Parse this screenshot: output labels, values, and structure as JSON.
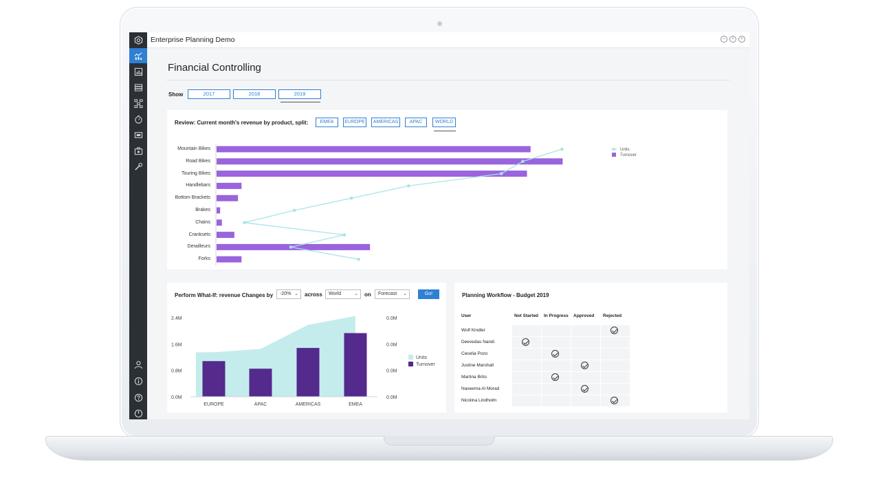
{
  "app": {
    "title": "Enterprise Planning Demo"
  },
  "page": {
    "title": "Financial Controlling"
  },
  "show": {
    "label": "Show",
    "years": [
      "2017",
      "2018",
      "2019"
    ],
    "selected": "2019"
  },
  "review": {
    "title": "Review: Current month's revenue by product, split:",
    "regions": [
      "EMEA",
      "EUROPE",
      "AMERICAS",
      "APAC",
      "WORLD"
    ],
    "selected_region": "WORLD"
  },
  "whatif": {
    "title": "Perform What-If: revenue Changes by",
    "change_value": "-20%",
    "across_label": "across",
    "region_value": "World",
    "on_label": "on",
    "scenario_value": "Forecast",
    "go_label": "Go!"
  },
  "workflow": {
    "title": "Planning Workflow - Budget 2019",
    "columns": [
      "User",
      "Not Started",
      "In Progress",
      "Approved",
      "Rejected"
    ],
    "rows": [
      {
        "user": "Wolf Kindler",
        "status": 3
      },
      {
        "user": "Deevedas Nandi",
        "status": 0
      },
      {
        "user": "Cecelia Pozo",
        "status": 1
      },
      {
        "user": "Justine Marshall",
        "status": 2
      },
      {
        "user": "Martina Brito",
        "status": 1
      },
      {
        "user": "Naseema Al Morad",
        "status": 2
      },
      {
        "user": "Nicolina Lindholm",
        "status": 3
      }
    ]
  },
  "colors": {
    "accent": "#2f7fd3",
    "bar": "#9a64dd",
    "line": "#a8e4e6",
    "turnover_dark": "#542a8c",
    "units_area": "#c5ecec",
    "sidebar": "#2b3036"
  },
  "sidebar": {
    "icons": [
      "hexagon-logo-icon",
      "bar-chart-icon",
      "report-icon",
      "list-icon",
      "hierarchy-icon",
      "timer-icon",
      "tv-icon",
      "briefcase-icon",
      "wrench-icon",
      "user-icon",
      "info-icon",
      "help-icon",
      "power-icon"
    ]
  },
  "chart_data": [
    {
      "type": "bar",
      "orientation": "horizontal",
      "categories": [
        "Mountain Bikes",
        "Road Bikes",
        "Touring Bikes",
        "Handlebars",
        "Bottom Brackets",
        "Brakes",
        "Chains",
        "Cranksets",
        "Derailleurs",
        "Forks"
      ],
      "series": [
        {
          "name": "Turnover",
          "type": "bar",
          "values": [
            88,
            97,
            87,
            7,
            6,
            1,
            1.5,
            5,
            43,
            7
          ]
        },
        {
          "name": "Units",
          "type": "line",
          "values": [
            97,
            86,
            80,
            54,
            38,
            22,
            8,
            36,
            21,
            40
          ]
        }
      ],
      "legend": "top-right",
      "grid": false
    },
    {
      "type": "bar",
      "categories": [
        "EUROPE",
        "APAC",
        "AMERICAS",
        "EMEA"
      ],
      "series": [
        {
          "name": "Turnover",
          "type": "bar",
          "values": [
            1.08,
            0.85,
            1.48,
            1.93
          ]
        },
        {
          "name": "Units",
          "type": "area",
          "values": [
            1.35,
            1.45,
            2.18,
            2.45
          ]
        }
      ],
      "y_ticks": [
        "0.0M",
        "0.8M",
        "1.6M",
        "2.4M"
      ],
      "y2_ticks": [
        "0.0M",
        "0.0M",
        "0.0M",
        "0.0M"
      ],
      "ylim": [
        0,
        2.4
      ],
      "legend": "right",
      "grid": false
    }
  ]
}
